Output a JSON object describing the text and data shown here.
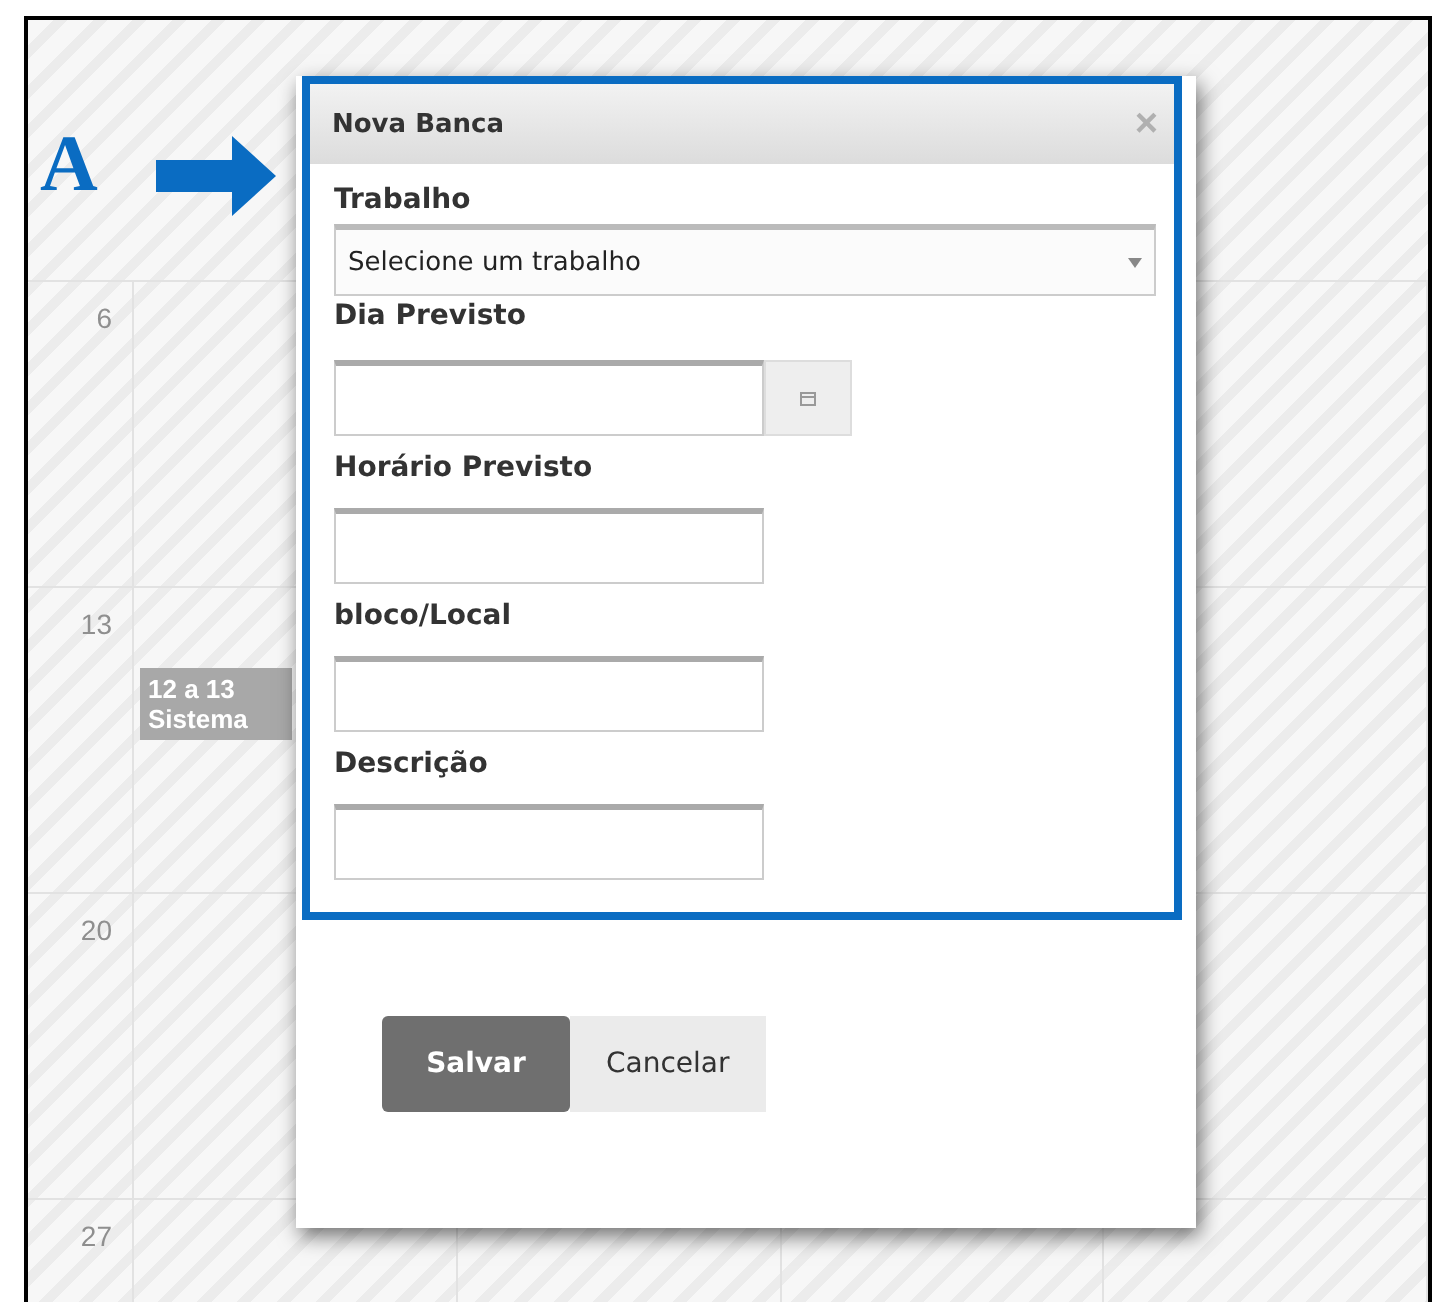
{
  "figure_label": "A",
  "calendar": {
    "day_numbers": [
      "6",
      "13",
      "20",
      "27"
    ],
    "events": [
      {
        "time": "12 a 13",
        "title": "Sistema"
      }
    ]
  },
  "dialog": {
    "title": "Nova Banca",
    "close": "×",
    "fields": [
      {
        "label": "Trabalho",
        "kind": "select",
        "value": "Selecione um trabalho"
      },
      {
        "label": "Dia Previsto",
        "kind": "date"
      },
      {
        "label": "Horário Previsto",
        "kind": "text"
      },
      {
        "label": "bloco/Local",
        "kind": "text"
      },
      {
        "label": "Descrição",
        "kind": "text"
      }
    ],
    "buttons": [
      {
        "label": "Salvar",
        "primary": true
      },
      {
        "label": "Cancelar",
        "primary": false
      }
    ]
  }
}
